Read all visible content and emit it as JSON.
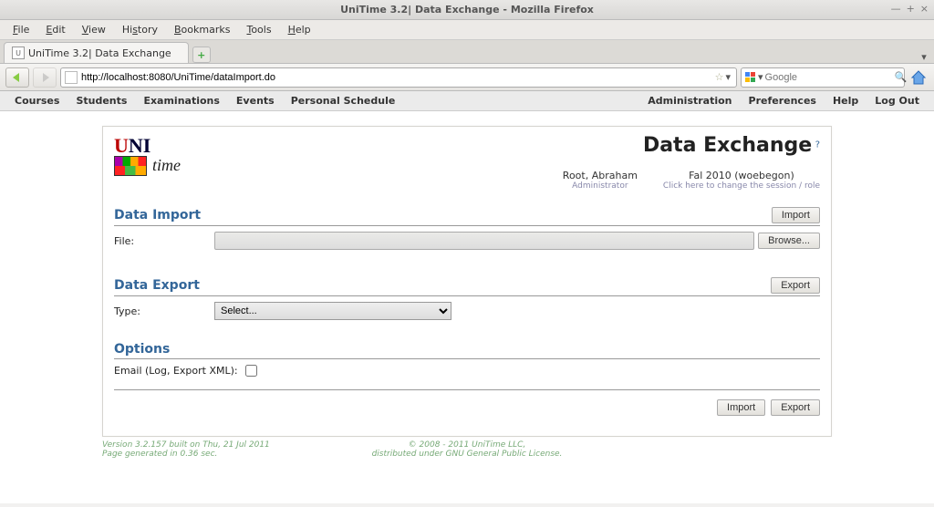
{
  "window": {
    "title": "UniTime 3.2| Data Exchange - Mozilla Firefox"
  },
  "menubar": [
    "File",
    "Edit",
    "View",
    "History",
    "Bookmarks",
    "Tools",
    "Help"
  ],
  "tab": {
    "label": "UniTime 3.2| Data Exchange"
  },
  "url": "http://localhost:8080/UniTime/dataImport.do",
  "search_placeholder": "Google",
  "appmenu": {
    "left": [
      "Courses",
      "Students",
      "Examinations",
      "Events",
      "Personal Schedule"
    ],
    "right": [
      "Administration",
      "Preferences",
      "Help",
      "Log Out"
    ]
  },
  "header": {
    "title": "Data Exchange",
    "user": "Root, Abraham",
    "role": "Administrator",
    "session": "Fal 2010 (woebegon)",
    "session_hint": "Click here to change the session / role"
  },
  "sections": {
    "import": {
      "title": "Data Import",
      "button": "Import",
      "file_label": "File:",
      "browse": "Browse..."
    },
    "export": {
      "title": "Data Export",
      "button": "Export",
      "type_label": "Type:",
      "select_placeholder": "Select..."
    },
    "options": {
      "title": "Options",
      "email_label": "Email (Log, Export XML):"
    }
  },
  "bottom": {
    "import": "Import",
    "export": "Export"
  },
  "footer": {
    "left1": "Version 3.2.157 built on Thu, 21 Jul 2011",
    "left2": "Page generated in 0.36 sec.",
    "mid1": "© 2008 - 2011 UniTime LLC,",
    "mid2": "distributed under GNU General Public License."
  }
}
